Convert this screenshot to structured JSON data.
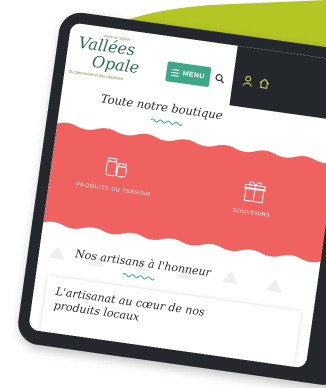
{
  "colors": {
    "blob": "#b4c624",
    "device_frame": "#24282c",
    "accent_green": "#3ea886",
    "coral": "#f0625f",
    "brand_green": "#2d6f4f"
  },
  "logo": {
    "tagline_top": "vivez un séjour",
    "brand_line1": "Vallées",
    "brand_line2": "Opale",
    "tagline_bottom": "Du patrimoine et des vacances"
  },
  "header": {
    "menu_label": "MENU",
    "icons": [
      "menu-icon",
      "search-icon",
      "user-icon",
      "home-icon"
    ]
  },
  "section1": {
    "title": "Toute notre boutique"
  },
  "categories": [
    {
      "label": "PRODUITS DU TERROIR",
      "icon": "jars-icon"
    },
    {
      "label": "SOUVENIRS",
      "icon": "gift-icon"
    }
  ],
  "section2": {
    "title": "Nos artisans à l'honneur"
  },
  "artisan_card": {
    "title": "L'artisanat au cœur de nos produits locaux"
  }
}
